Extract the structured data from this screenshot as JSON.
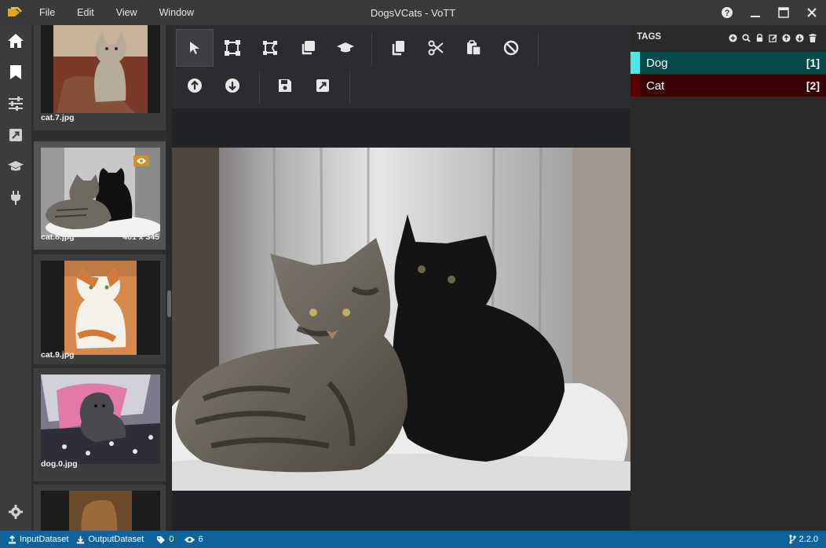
{
  "app": {
    "title": "DogsVCats - VoTT",
    "menu": [
      "File",
      "Edit",
      "View",
      "Window"
    ]
  },
  "thumbnails": [
    {
      "name": "cat.7.jpg",
      "dims": "",
      "active": false
    },
    {
      "name": "cat.8.jpg",
      "dims": "461 x 345",
      "active": true
    },
    {
      "name": "cat.9.jpg",
      "dims": "",
      "active": false
    },
    {
      "name": "dog.0.jpg",
      "dims": "",
      "active": false
    }
  ],
  "tags": {
    "header": "TAGS",
    "items": [
      {
        "name": "Dog",
        "key": "[1]",
        "color": "#4ee6e6",
        "bg": "#064b4b"
      },
      {
        "name": "Cat",
        "key": "[2]",
        "color": "#5a0000",
        "bg": "#3a0404"
      }
    ]
  },
  "status": {
    "input": "InputDataset",
    "output": "OutputDataset",
    "tag_count": "0",
    "visited_count": "6",
    "version": "2.2.0"
  },
  "colors": {
    "accent": "#0e639c",
    "visited_badge": "#c8922b"
  }
}
